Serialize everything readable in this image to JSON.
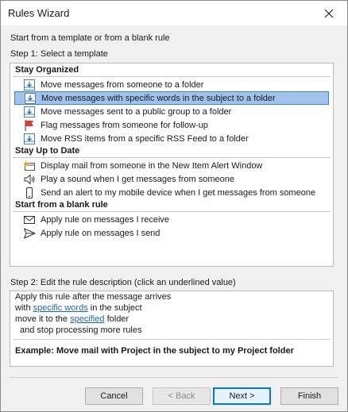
{
  "window": {
    "title": "Rules Wizard"
  },
  "intro": "Start from a template or from a blank rule",
  "step1": "Step 1: Select a template",
  "groups": [
    {
      "title": "Stay Organized",
      "items": [
        {
          "label": "Move messages from someone to a folder",
          "icon": "folder-move-icon"
        },
        {
          "label": "Move messages with specific words in the subject to a folder",
          "icon": "folder-move-icon",
          "selected": true
        },
        {
          "label": "Move messages sent to a public group to a folder",
          "icon": "folder-move-icon"
        },
        {
          "label": "Flag messages from someone for follow-up",
          "icon": "flag-icon"
        },
        {
          "label": "Move RSS items from a specific RSS Feed to a folder",
          "icon": "folder-move-icon"
        }
      ]
    },
    {
      "title": "Stay Up to Date",
      "items": [
        {
          "label": "Display mail from someone in the New Item Alert Window",
          "icon": "alert-window-icon"
        },
        {
          "label": "Play a sound when I get messages from someone",
          "icon": "speaker-icon"
        },
        {
          "label": "Send an alert to my mobile device when I get messages from someone",
          "icon": "mobile-icon"
        }
      ]
    },
    {
      "title": "Start from a blank rule",
      "items": [
        {
          "label": "Apply rule on messages I receive",
          "icon": "envelope-icon"
        },
        {
          "label": "Apply rule on messages I send",
          "icon": "send-icon"
        }
      ]
    }
  ],
  "step2": "Step 2: Edit the rule description (click an underlined value)",
  "description": {
    "line1": "Apply this rule after the message arrives",
    "line2_pre": "with ",
    "line2_link": "specific words",
    "line2_post": " in the subject",
    "line3_pre": "move it to the ",
    "line3_link": "specified",
    "line3_post": " folder",
    "line4": "and stop processing more rules",
    "example": "Example: Move mail with Project in the subject to my Project folder"
  },
  "buttons": {
    "cancel": "Cancel",
    "back": "< Back",
    "next": "Next >",
    "finish": "Finish"
  },
  "colors": {
    "selection": "#9fc3ea",
    "link": "#1b67b3",
    "default_button_border": "#0078d7"
  }
}
